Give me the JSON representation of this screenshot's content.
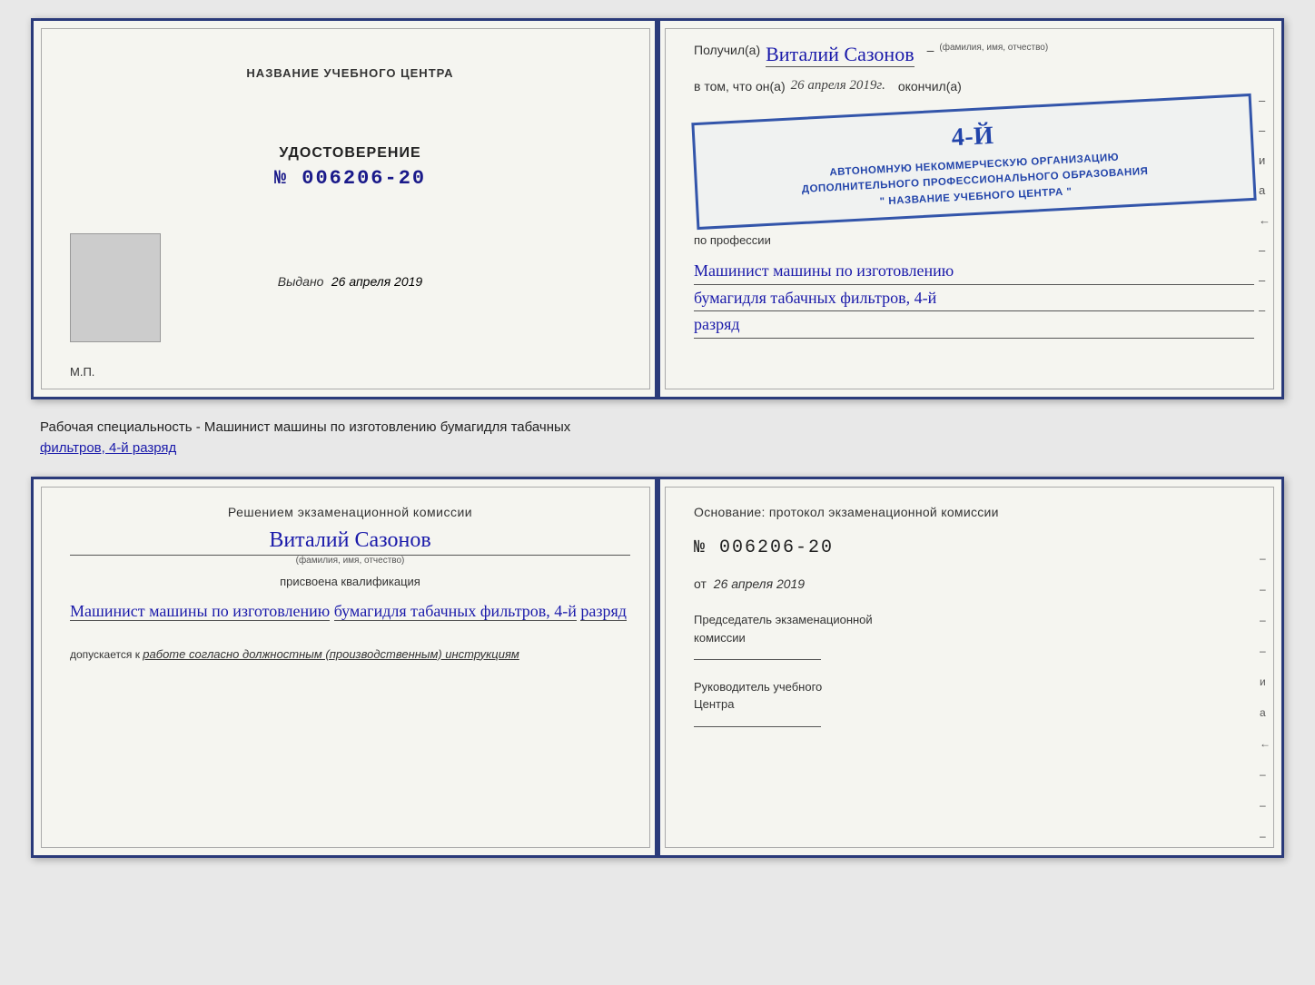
{
  "top_cert": {
    "left": {
      "school_name_label": "НАЗВАНИЕ УЧЕБНОГО ЦЕНТРА",
      "udostoverenie_title": "УДОСТОВЕРЕНИЕ",
      "number": "№ 006206-20",
      "vydano_label": "Выдано",
      "vydano_date": "26 апреля 2019",
      "mp_label": "М.П."
    },
    "right": {
      "poluchil_label": "Получил(а)",
      "name_handwritten": "Виталий Сазонов",
      "fio_hint": "(фамилия, имя, отчество)",
      "dash": "–",
      "v_tom_prefix": "в том, что он(а)",
      "date_handwritten": "26 апреля 2019г.",
      "okonchil": "окончил(а)",
      "stamp_number": "4-й",
      "stamp_line1": "АВТОНОМНУЮ НЕКОММЕРЧЕСКУЮ ОРГАНИЗАЦИЮ",
      "stamp_line2": "ДОПОЛНИТЕЛЬНОГО ПРОФЕССИОНАЛЬНОГО ОБРАЗОВАНИЯ",
      "stamp_quote_open": "\"",
      "stamp_center": "НАЗВАНИЕ УЧЕБНОГО ЦЕНТРА",
      "stamp_quote_close": "\"",
      "po_professii": "по профессии",
      "profession_line1": "Машинист машины по изготовлению",
      "profession_line2": "бумагидля табачных фильтров, 4-й",
      "profession_line3": "разряд",
      "right_marks": [
        "–",
        "–",
        "и",
        "а",
        "←",
        "–",
        "–",
        "–",
        "–"
      ]
    }
  },
  "between_text": {
    "main": "Рабочая специальность - Машинист машины по изготовлению бумагидля табачных",
    "underline": "фильтров, 4-й разряд"
  },
  "bottom_cert": {
    "left": {
      "resheniem": "Решением экзаменационной комиссии",
      "name_handwritten": "Виталий Сазонов",
      "fio_hint": "(фамилия, имя, отчество)",
      "prisvoena": "присвоена квалификация",
      "qualification_line1": "Машинист машины по изготовлению",
      "qualification_line2": "бумагидля табачных фильтров, 4-й",
      "qualification_line3": "разряд",
      "dopuskaetsya_prefix": "допускается к",
      "dopuskaetsya_italic": "работе согласно должностным (производственным) инструкциям"
    },
    "right": {
      "osnovanie": "Основание: протокол экзаменационной комиссии",
      "number": "№ 006206-20",
      "ot_label": "от",
      "ot_date": "26 апреля 2019",
      "predsedatel_line1": "Председатель экзаменационной",
      "predsedatel_line2": "комиссии",
      "rukovoditel_line1": "Руководитель учебного",
      "rukovoditel_line2": "Центра",
      "right_marks": [
        "–",
        "–",
        "–",
        "–",
        "и",
        "а",
        "←",
        "–",
        "–",
        "–",
        "–"
      ]
    }
  }
}
